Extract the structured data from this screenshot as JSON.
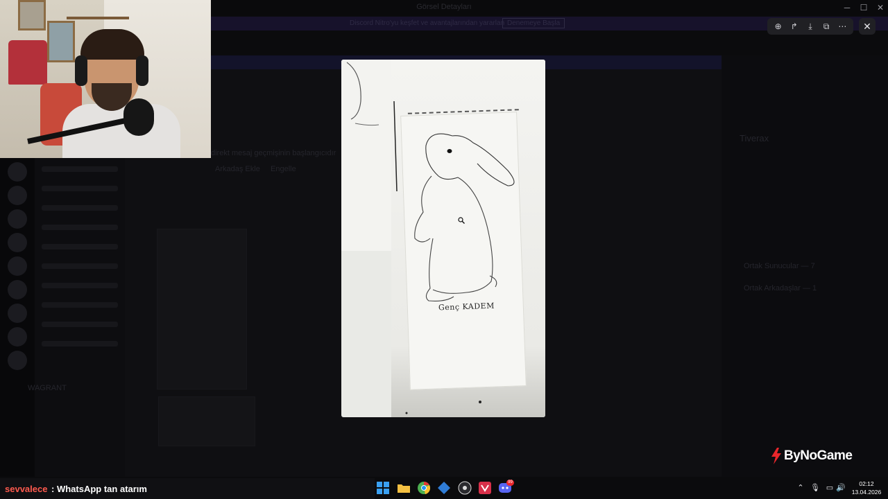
{
  "window": {
    "title": "Görsel Detayları",
    "controls": [
      "─",
      "☐",
      "✕"
    ]
  },
  "background": {
    "banner_text": "Discord Nitro'yu keşfet ve avantajlarından yararlan",
    "banner_button": "Denemeye Başla",
    "chat_hint": "direkt mesaj geçmişinin başlangıcıdır",
    "tabs": [
      "Arkadaş Ekle",
      "Engelle"
    ],
    "profile_name": "Tiverax",
    "sections": [
      "Ortak Sunucular — 7",
      "Ortak Arkadaşlar — 1"
    ],
    "server_label": "WAGRANT"
  },
  "viewer": {
    "toolbar": [
      {
        "name": "zoom-icon",
        "glyph": "⊕"
      },
      {
        "name": "forward-icon",
        "glyph": "↱"
      },
      {
        "name": "download-icon",
        "glyph": "⤓"
      },
      {
        "name": "open-external-icon",
        "glyph": "⧉"
      },
      {
        "name": "more-icon",
        "glyph": "⋯"
      }
    ],
    "close_glyph": "✕",
    "image_caption": "Genç KADEM"
  },
  "branding": {
    "sponsor": "ByNoGame",
    "accent": "#e8262b"
  },
  "chat_overlay": {
    "username": "sevvalece",
    "separator": ":",
    "message": "WhatsApp tan atarım",
    "username_color": "#ff5a4e"
  },
  "taskbar": {
    "apps": [
      {
        "name": "windows-start-icon",
        "color": "#3aa0f2"
      },
      {
        "name": "file-explorer-icon",
        "color": "#f4c042"
      },
      {
        "name": "chrome-icon",
        "color": "#4caf50"
      },
      {
        "name": "app-icon-blue",
        "color": "#2f7cd6"
      },
      {
        "name": "obs-icon",
        "color": "#2a2a2e"
      },
      {
        "name": "app-icon-red",
        "color": "#d8304a"
      },
      {
        "name": "discord-icon",
        "color": "#5865f2"
      }
    ],
    "discord_badge": "99",
    "tray": [
      {
        "name": "chevron-up-icon",
        "glyph": "⌃"
      },
      {
        "name": "mic-icon",
        "glyph": "🎙"
      },
      {
        "name": "network-icon",
        "glyph": "▭"
      },
      {
        "name": "volume-icon",
        "glyph": "🔊"
      }
    ],
    "time": "02:12",
    "date": "13.04.2026"
  }
}
